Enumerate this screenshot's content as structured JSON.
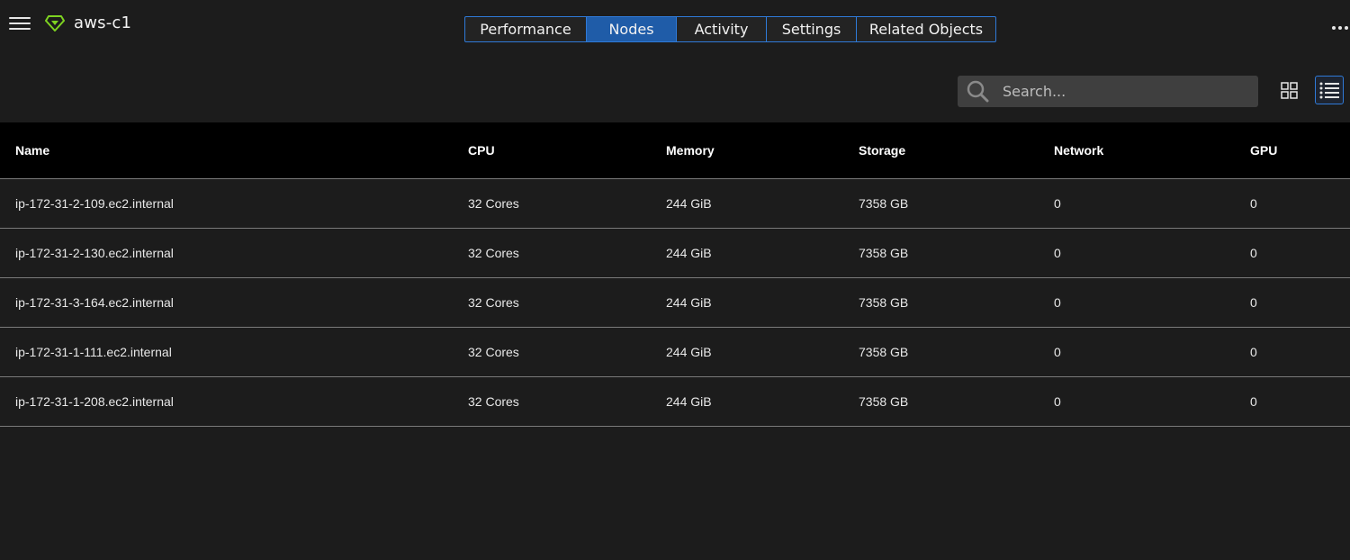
{
  "header": {
    "title": "aws-c1"
  },
  "tabs": [
    {
      "label": "Performance",
      "active": false
    },
    {
      "label": "Nodes",
      "active": true
    },
    {
      "label": "Activity",
      "active": false
    },
    {
      "label": "Settings",
      "active": false
    },
    {
      "label": "Related Objects",
      "active": false
    }
  ],
  "toolbar": {
    "search_placeholder": "Search...",
    "active_view": "list"
  },
  "table": {
    "columns": [
      "Name",
      "CPU",
      "Memory",
      "Storage",
      "Network",
      "GPU"
    ],
    "rows": [
      {
        "name": "ip-172-31-2-109.ec2.internal",
        "cpu": "32 Cores",
        "memory": "244 GiB",
        "storage": "7358 GB",
        "network": "0",
        "gpu": "0"
      },
      {
        "name": "ip-172-31-2-130.ec2.internal",
        "cpu": "32 Cores",
        "memory": "244 GiB",
        "storage": "7358 GB",
        "network": "0",
        "gpu": "0"
      },
      {
        "name": "ip-172-31-3-164.ec2.internal",
        "cpu": "32 Cores",
        "memory": "244 GiB",
        "storage": "7358 GB",
        "network": "0",
        "gpu": "0"
      },
      {
        "name": "ip-172-31-1-111.ec2.internal",
        "cpu": "32 Cores",
        "memory": "244 GiB",
        "storage": "7358 GB",
        "network": "0",
        "gpu": "0"
      },
      {
        "name": "ip-172-31-1-208.ec2.internal",
        "cpu": "32 Cores",
        "memory": "244 GiB",
        "storage": "7358 GB",
        "network": "0",
        "gpu": "0"
      }
    ]
  },
  "colors": {
    "background": "#1c1c1c",
    "accent": "#2f7ad8",
    "active_tab": "#1f5ca8",
    "logo": "#7ed321",
    "header_row": "#000000"
  },
  "icons": {
    "menu": "hamburger-icon",
    "logo": "diamond-logo-icon",
    "more": "more-dots-icon",
    "search": "search-icon",
    "grid": "grid-view-icon",
    "list": "list-view-icon"
  }
}
